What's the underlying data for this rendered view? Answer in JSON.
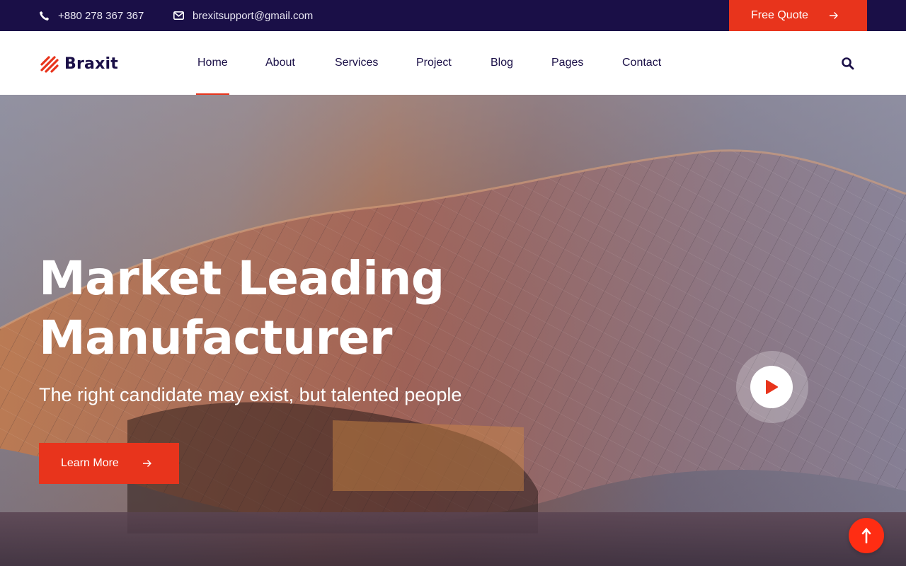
{
  "topbar": {
    "phone": "+880 278 367 367",
    "email": "brexitsupport@gmail.com",
    "quote_label": "Free Quote"
  },
  "brand": {
    "name": "Braxit"
  },
  "nav": {
    "items": [
      {
        "label": "Home",
        "active": true
      },
      {
        "label": "About",
        "active": false
      },
      {
        "label": "Services",
        "active": false
      },
      {
        "label": "Project",
        "active": false
      },
      {
        "label": "Blog",
        "active": false
      },
      {
        "label": "Pages",
        "active": false
      },
      {
        "label": "Contact",
        "active": false
      }
    ]
  },
  "hero": {
    "title_line1": "Market Leading",
    "title_line2": "Manufacturer",
    "subtitle": "The right candidate may exist, but talented people",
    "cta_label": "Learn More"
  },
  "colors": {
    "navy": "#1a0f47",
    "accent": "#e8341c"
  },
  "icons": [
    "phone-icon",
    "envelope-icon",
    "arrow-right-icon",
    "search-icon",
    "play-icon",
    "arrow-up-icon",
    "logo-stripes-icon"
  ]
}
